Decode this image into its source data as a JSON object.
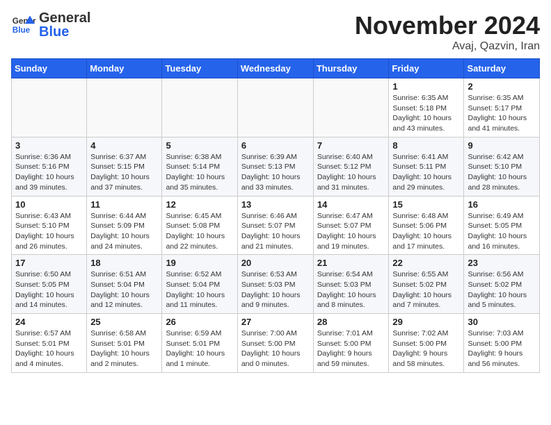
{
  "header": {
    "logo_general": "General",
    "logo_blue": "Blue",
    "month_title": "November 2024",
    "location": "Avaj, Qazvin, Iran"
  },
  "columns": [
    "Sunday",
    "Monday",
    "Tuesday",
    "Wednesday",
    "Thursday",
    "Friday",
    "Saturday"
  ],
  "weeks": [
    [
      {
        "day": "",
        "info": ""
      },
      {
        "day": "",
        "info": ""
      },
      {
        "day": "",
        "info": ""
      },
      {
        "day": "",
        "info": ""
      },
      {
        "day": "",
        "info": ""
      },
      {
        "day": "1",
        "info": "Sunrise: 6:35 AM\nSunset: 5:18 PM\nDaylight: 10 hours and 43 minutes."
      },
      {
        "day": "2",
        "info": "Sunrise: 6:35 AM\nSunset: 5:17 PM\nDaylight: 10 hours and 41 minutes."
      }
    ],
    [
      {
        "day": "3",
        "info": "Sunrise: 6:36 AM\nSunset: 5:16 PM\nDaylight: 10 hours and 39 minutes."
      },
      {
        "day": "4",
        "info": "Sunrise: 6:37 AM\nSunset: 5:15 PM\nDaylight: 10 hours and 37 minutes."
      },
      {
        "day": "5",
        "info": "Sunrise: 6:38 AM\nSunset: 5:14 PM\nDaylight: 10 hours and 35 minutes."
      },
      {
        "day": "6",
        "info": "Sunrise: 6:39 AM\nSunset: 5:13 PM\nDaylight: 10 hours and 33 minutes."
      },
      {
        "day": "7",
        "info": "Sunrise: 6:40 AM\nSunset: 5:12 PM\nDaylight: 10 hours and 31 minutes."
      },
      {
        "day": "8",
        "info": "Sunrise: 6:41 AM\nSunset: 5:11 PM\nDaylight: 10 hours and 29 minutes."
      },
      {
        "day": "9",
        "info": "Sunrise: 6:42 AM\nSunset: 5:10 PM\nDaylight: 10 hours and 28 minutes."
      }
    ],
    [
      {
        "day": "10",
        "info": "Sunrise: 6:43 AM\nSunset: 5:10 PM\nDaylight: 10 hours and 26 minutes."
      },
      {
        "day": "11",
        "info": "Sunrise: 6:44 AM\nSunset: 5:09 PM\nDaylight: 10 hours and 24 minutes."
      },
      {
        "day": "12",
        "info": "Sunrise: 6:45 AM\nSunset: 5:08 PM\nDaylight: 10 hours and 22 minutes."
      },
      {
        "day": "13",
        "info": "Sunrise: 6:46 AM\nSunset: 5:07 PM\nDaylight: 10 hours and 21 minutes."
      },
      {
        "day": "14",
        "info": "Sunrise: 6:47 AM\nSunset: 5:07 PM\nDaylight: 10 hours and 19 minutes."
      },
      {
        "day": "15",
        "info": "Sunrise: 6:48 AM\nSunset: 5:06 PM\nDaylight: 10 hours and 17 minutes."
      },
      {
        "day": "16",
        "info": "Sunrise: 6:49 AM\nSunset: 5:05 PM\nDaylight: 10 hours and 16 minutes."
      }
    ],
    [
      {
        "day": "17",
        "info": "Sunrise: 6:50 AM\nSunset: 5:05 PM\nDaylight: 10 hours and 14 minutes."
      },
      {
        "day": "18",
        "info": "Sunrise: 6:51 AM\nSunset: 5:04 PM\nDaylight: 10 hours and 12 minutes."
      },
      {
        "day": "19",
        "info": "Sunrise: 6:52 AM\nSunset: 5:04 PM\nDaylight: 10 hours and 11 minutes."
      },
      {
        "day": "20",
        "info": "Sunrise: 6:53 AM\nSunset: 5:03 PM\nDaylight: 10 hours and 9 minutes."
      },
      {
        "day": "21",
        "info": "Sunrise: 6:54 AM\nSunset: 5:03 PM\nDaylight: 10 hours and 8 minutes."
      },
      {
        "day": "22",
        "info": "Sunrise: 6:55 AM\nSunset: 5:02 PM\nDaylight: 10 hours and 7 minutes."
      },
      {
        "day": "23",
        "info": "Sunrise: 6:56 AM\nSunset: 5:02 PM\nDaylight: 10 hours and 5 minutes."
      }
    ],
    [
      {
        "day": "24",
        "info": "Sunrise: 6:57 AM\nSunset: 5:01 PM\nDaylight: 10 hours and 4 minutes."
      },
      {
        "day": "25",
        "info": "Sunrise: 6:58 AM\nSunset: 5:01 PM\nDaylight: 10 hours and 2 minutes."
      },
      {
        "day": "26",
        "info": "Sunrise: 6:59 AM\nSunset: 5:01 PM\nDaylight: 10 hours and 1 minute."
      },
      {
        "day": "27",
        "info": "Sunrise: 7:00 AM\nSunset: 5:00 PM\nDaylight: 10 hours and 0 minutes."
      },
      {
        "day": "28",
        "info": "Sunrise: 7:01 AM\nSunset: 5:00 PM\nDaylight: 9 hours and 59 minutes."
      },
      {
        "day": "29",
        "info": "Sunrise: 7:02 AM\nSunset: 5:00 PM\nDaylight: 9 hours and 58 minutes."
      },
      {
        "day": "30",
        "info": "Sunrise: 7:03 AM\nSunset: 5:00 PM\nDaylight: 9 hours and 56 minutes."
      }
    ]
  ]
}
